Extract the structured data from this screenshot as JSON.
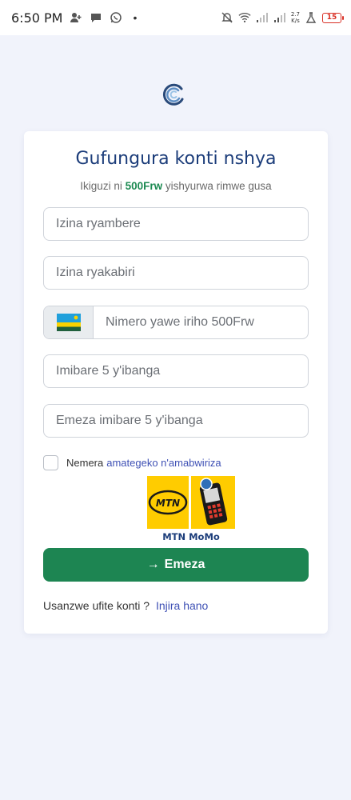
{
  "status_bar": {
    "time": "6:50 PM",
    "speed_top": "2.7",
    "speed_bottom": "K/s",
    "battery": "15",
    "left_icons": [
      "person-add-icon",
      "chat-bubble-icon",
      "whatsapp-icon"
    ],
    "right_icons": [
      "notifications-off-icon",
      "wifi-icon",
      "signal-icon",
      "signal-icon",
      "flask-icon",
      "battery-icon"
    ]
  },
  "form": {
    "title": "Gufungura konti nshya",
    "subtitle_prefix": "Ikiguzi ni",
    "subtitle_price": "500Frw",
    "subtitle_suffix": "yishyurwa rimwe gusa",
    "first_name_placeholder": "Izina ryambere",
    "last_name_placeholder": "Izina ryakabiri",
    "phone_placeholder": "Nimero yawe iriho 500Frw",
    "pin_placeholder": "Imibare 5 y'ibanga",
    "confirm_pin_placeholder": "Emeza imibare 5 y'ibanga",
    "terms_prefix": "Nemera",
    "terms_link": "amategeko n'amabwiriza",
    "payment_logo_text": "MTN",
    "payment_caption": "MTN MoMo",
    "submit_label": "Emeza",
    "login_prompt": "Usanzwe ufite konti ?",
    "login_link": "Injira hano"
  },
  "colors": {
    "background": "#f1f3fb",
    "title": "#1c3d7a",
    "accent_green": "#1d8552",
    "link": "#3f51b5",
    "mtn_yellow": "#ffcc00"
  }
}
